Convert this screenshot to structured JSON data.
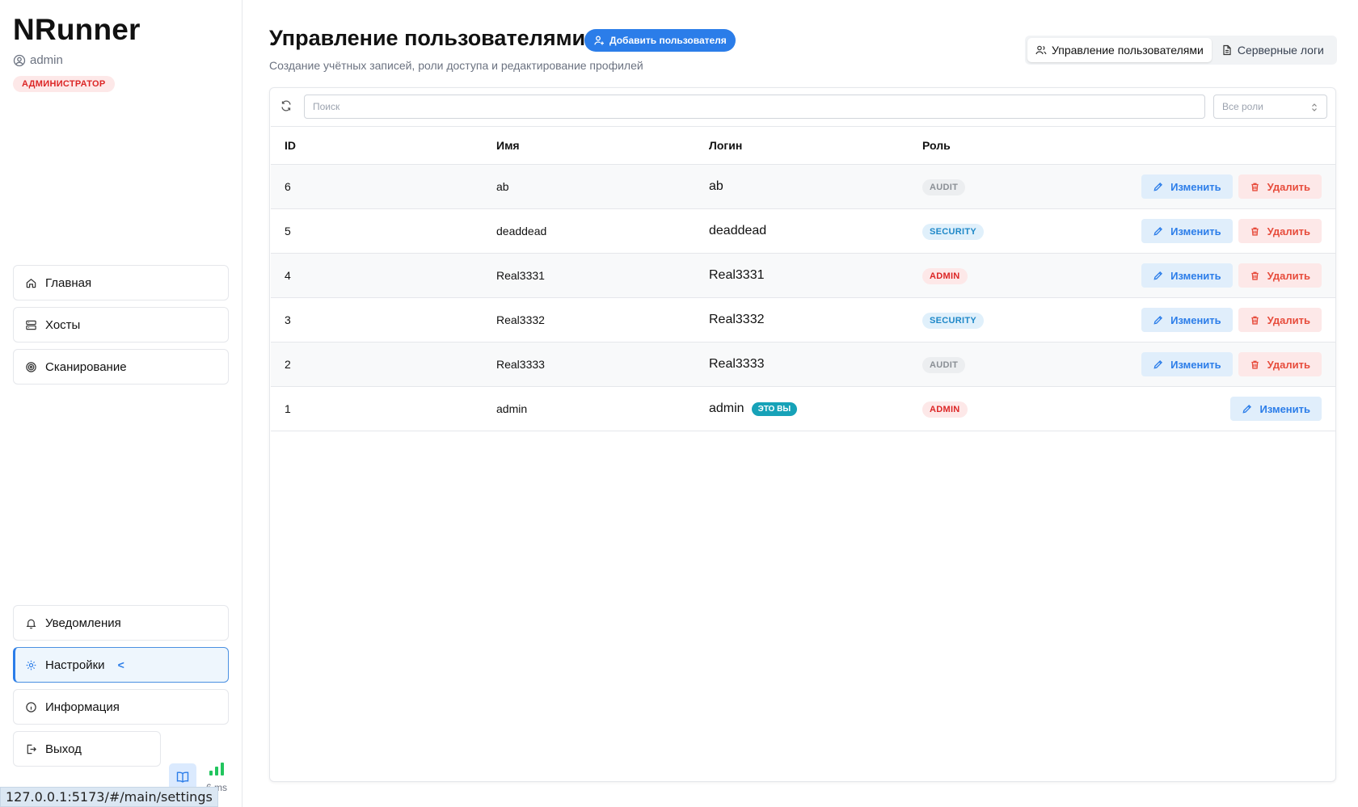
{
  "app": {
    "brand": "NRunner",
    "username": "admin",
    "role_label": "АДМИНИСТРАТОР"
  },
  "nav": {
    "top": [
      {
        "label": "Главная",
        "icon": "home-icon"
      },
      {
        "label": "Хосты",
        "icon": "server-icon"
      },
      {
        "label": "Сканирование",
        "icon": "target-icon"
      }
    ],
    "bottom": [
      {
        "label": "Уведомления",
        "icon": "bell-icon"
      },
      {
        "label": "Настройки",
        "icon": "gear-icon",
        "active": true,
        "marker": "<"
      },
      {
        "label": "Информация",
        "icon": "info-icon"
      }
    ],
    "logout": "Выход",
    "latency": "6 ms"
  },
  "status_url": "127.0.0.1:5173/#/main/settings",
  "page": {
    "title": "Управление пользователями",
    "add_button": "Добавить пользователя",
    "subtitle": "Создание учётных записей, роли доступа и редактирование профилей",
    "tabs": [
      {
        "label": "Управление пользователями",
        "active": true
      },
      {
        "label": "Серверные логи",
        "active": false
      }
    ]
  },
  "filters": {
    "search_placeholder": "Поиск",
    "role_select": "Все роли"
  },
  "table": {
    "headers": {
      "id": "ID",
      "name": "Имя",
      "login": "Логин",
      "role": "Роль"
    },
    "edit_label": "Изменить",
    "delete_label": "Удалить",
    "you_badge": "ЭТО ВЫ",
    "rows": [
      {
        "id": "6",
        "name": "ab",
        "login": "ab",
        "role": "AUDIT"
      },
      {
        "id": "5",
        "name": "deaddead",
        "login": "deaddead",
        "role": "SECURITY"
      },
      {
        "id": "4",
        "name": "Real3331",
        "login": "Real3331",
        "role": "ADMIN"
      },
      {
        "id": "3",
        "name": "Real3332",
        "login": "Real3332",
        "role": "SECURITY"
      },
      {
        "id": "2",
        "name": "Real3333",
        "login": "Real3333",
        "role": "AUDIT"
      },
      {
        "id": "1",
        "name": "admin",
        "login": "admin",
        "role": "ADMIN"
      }
    ]
  },
  "colors": {
    "accent": "#2b7de9",
    "danger": "#dc2626",
    "success": "#22c55e",
    "you_badge": "#17a2b8"
  }
}
